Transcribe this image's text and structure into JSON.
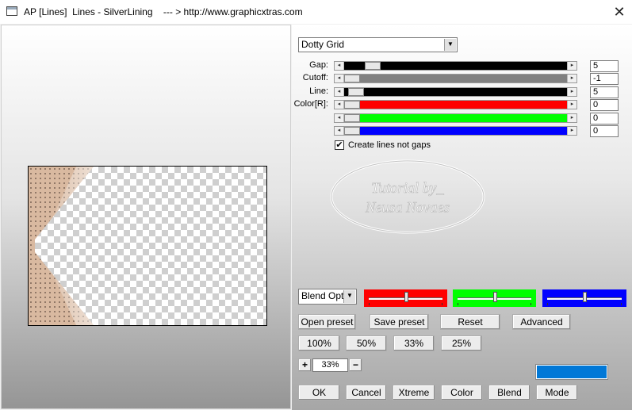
{
  "window": {
    "title": "AP [Lines]  Lines - SilverLining    --- > http://www.graphicxtras.com",
    "close_glyph": "✕"
  },
  "preset_combo": {
    "value": "Dotty Grid",
    "arrow": "▼"
  },
  "sliders": [
    {
      "label": "Gap:",
      "value": "5",
      "fill_color": "#000000",
      "level": 0.1
    },
    {
      "label": "Cutoff:",
      "value": "-1",
      "fill_color": "#808080",
      "level": 0.0
    },
    {
      "label": "Line:",
      "value": "5",
      "fill_color": "#000000",
      "level": 0.02
    },
    {
      "label": "Color[R]:",
      "value": "0",
      "fill_color": "#ff0000",
      "level": 0.0
    },
    {
      "label": "",
      "value": "0",
      "fill_color": "#00ff00",
      "level": 0.0
    },
    {
      "label": "",
      "value": "0",
      "fill_color": "#0000ff",
      "level": 0.0
    }
  ],
  "checkbox": {
    "label": "Create lines not gaps",
    "checked": true,
    "mark": "✔"
  },
  "watermark": {
    "line1": "Tutorial by_",
    "line2": "Neusa Novaes"
  },
  "blend_combo": {
    "value": "Blend Optio",
    "arrow": "▼"
  },
  "color_boxes": [
    {
      "color": "#ff0000",
      "level": 0.5
    },
    {
      "color": "#00ff00",
      "level": 0.5
    },
    {
      "color": "#0000ff",
      "level": 0.5
    }
  ],
  "buttons": {
    "open_preset": "Open preset",
    "save_preset": "Save preset",
    "reset": "Reset",
    "advanced": "Advanced",
    "zoom_100": "100%",
    "zoom_50": "50%",
    "zoom_33": "33%",
    "zoom_25": "25%",
    "plus": "+",
    "minus": "−",
    "ok": "OK",
    "cancel": "Cancel",
    "xtreme": "Xtreme",
    "color": "Color",
    "blend": "Blend",
    "mode": "Mode"
  },
  "zoom_value": "33%",
  "swatch_color": "#0078d7",
  "preview_colors": {
    "fabric": "#d9b9a0",
    "dots": "#5e4a3e"
  }
}
